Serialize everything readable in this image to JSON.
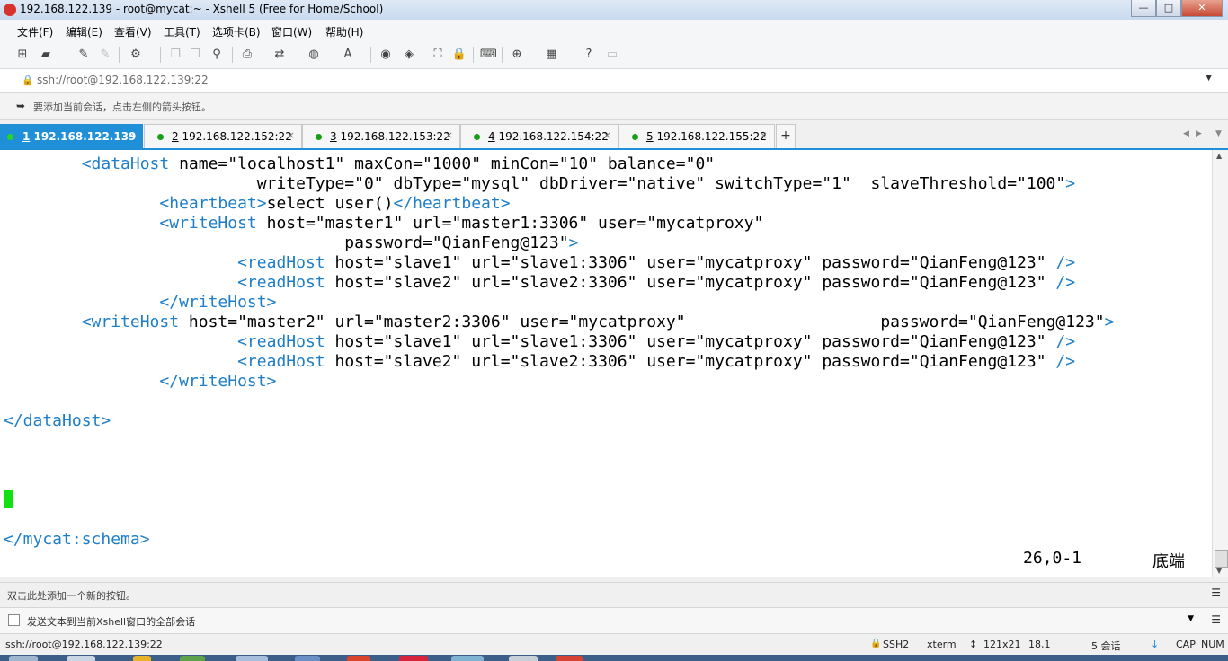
{
  "window": {
    "title": "192.168.122.139 - root@mycat:~ - Xshell 5 (Free for Home/School)",
    "min": "—",
    "max": "□",
    "close": "✕"
  },
  "menu": [
    "文件(F)",
    "编辑(E)",
    "查看(V)",
    "工具(T)",
    "选项卡(B)",
    "窗口(W)",
    "帮助(H)"
  ],
  "address": {
    "value": "ssh://root@192.168.122.139:22"
  },
  "hint": "要添加当前会话，点击左侧的箭头按钮。",
  "tabs": [
    {
      "num": "1",
      "label": " 192.168.122.139"
    },
    {
      "num": "2",
      "label": " 192.168.122.152:22"
    },
    {
      "num": "3",
      "label": " 192.168.122.153:22"
    },
    {
      "num": "4",
      "label": " 192.168.122.154:22"
    },
    {
      "num": "5",
      "label": " 192.168.122.155:22"
    }
  ],
  "tab_add": "+",
  "tab_close": "×",
  "terminal": {
    "lines": [
      {
        "indent": "        ",
        "segments": [
          [
            "tag",
            "<dataHost"
          ],
          [
            "val",
            " name=\"localhost1\" maxCon=\"1000\" minCon=\"10\" balance=\"0\""
          ]
        ]
      },
      {
        "indent": "                          ",
        "segments": [
          [
            "val",
            "writeType=\"0\" dbType=\"mysql\" dbDriver=\"native\" switchType=\"1\"  slaveThreshold=\"100\""
          ],
          [
            "tag",
            ">"
          ]
        ]
      },
      {
        "indent": "                ",
        "segments": [
          [
            "tag",
            "<heartbeat>"
          ],
          [
            "val",
            "select user()"
          ],
          [
            "tag",
            "</heartbeat>"
          ]
        ]
      },
      {
        "indent": "                ",
        "segments": [
          [
            "tag",
            "<writeHost"
          ],
          [
            "val",
            " host=\"master1\" url=\"master1:3306\" user=\"mycatproxy\""
          ]
        ]
      },
      {
        "indent": "                                   ",
        "segments": [
          [
            "val",
            "password=\"QianFeng@123\""
          ],
          [
            "tag",
            ">"
          ]
        ]
      },
      {
        "indent": "                        ",
        "segments": [
          [
            "tag",
            "<readHost"
          ],
          [
            "val",
            " host=\"slave1\" url=\"slave1:3306\" user=\"mycatproxy\" password=\"QianFeng@123\" "
          ],
          [
            "tag",
            "/>"
          ]
        ]
      },
      {
        "indent": "                        ",
        "segments": [
          [
            "tag",
            "<readHost"
          ],
          [
            "val",
            " host=\"slave2\" url=\"slave2:3306\" user=\"mycatproxy\" password=\"QianFeng@123\" "
          ],
          [
            "tag",
            "/>"
          ]
        ]
      },
      {
        "indent": "                ",
        "segments": [
          [
            "tag",
            "</writeHost>"
          ]
        ]
      },
      {
        "indent": "        ",
        "segments": [
          [
            "tag",
            "<writeHost"
          ],
          [
            "val",
            " host=\"master2\" url=\"master2:3306\" user=\"mycatproxy\"                    password=\"QianFeng@123\""
          ],
          [
            "tag",
            ">"
          ]
        ]
      },
      {
        "indent": "                        ",
        "segments": [
          [
            "tag",
            "<readHost"
          ],
          [
            "val",
            " host=\"slave1\" url=\"slave1:3306\" user=\"mycatproxy\" password=\"QianFeng@123\" "
          ],
          [
            "tag",
            "/>"
          ]
        ]
      },
      {
        "indent": "                        ",
        "segments": [
          [
            "tag",
            "<readHost"
          ],
          [
            "val",
            " host=\"slave2\" url=\"slave2:3306\" user=\"mycatproxy\" password=\"QianFeng@123\" "
          ],
          [
            "tag",
            "/>"
          ]
        ]
      },
      {
        "indent": "                ",
        "segments": [
          [
            "tag",
            "</writeHost>"
          ]
        ]
      },
      {
        "indent": "",
        "segments": []
      },
      {
        "indent": "",
        "segments": [
          [
            "tag",
            "</dataHost>"
          ]
        ]
      },
      {
        "indent": "",
        "segments": []
      },
      {
        "indent": "",
        "segments": []
      },
      {
        "indent": "",
        "segments": []
      },
      {
        "indent": "",
        "segments": []
      },
      {
        "indent": "",
        "segments": []
      },
      {
        "indent": "",
        "segments": [
          [
            "tag",
            "</mycat:schema>"
          ]
        ]
      }
    ],
    "cursor_pos": "26,0-1",
    "scroll_status": "底端"
  },
  "quick_command": "双击此处添加一个新的按钮。",
  "compose": "发送文本到当前Xshell窗口的全部会话",
  "status": {
    "connection": "ssh://root@192.168.122.139:22",
    "protocol": "SSH2",
    "terminal": "xterm",
    "size": "121x21",
    "cursor": "18,1",
    "sessions": "5 会话",
    "caps": "CAP",
    "num": "NUM"
  },
  "colors": {
    "accent": "#1f8fd8",
    "tag": "#1e7ec8",
    "cursor": "#11e011",
    "session_dot": "#16a016"
  }
}
